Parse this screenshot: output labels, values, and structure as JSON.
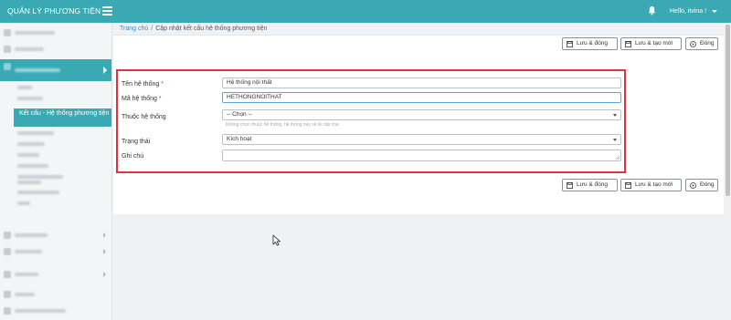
{
  "header": {
    "app_title": "QUẢN LÝ PHƯƠNG TIỆN",
    "user_greeting": "Hello, itvina !",
    "colors": {
      "brand": "#3aa9b4",
      "required": "#e0333a",
      "link": "#2f8fd6"
    },
    "icons": [
      "menu-icon",
      "bell-icon",
      "caret-down-icon"
    ]
  },
  "sidebar": {
    "current_item_label": "Kết cấu - Hệ thống phương tiện",
    "note": "other sidebar labels are blurred in the screenshot"
  },
  "breadcrumb": {
    "home": "Trang chủ",
    "separator": "/",
    "current": "Cập nhật kết cấu hệ thống phương tiện"
  },
  "toolbar": {
    "save_close": "Lưu & đóng",
    "save_new": "Lưu & tạo mới",
    "close": "Đóng"
  },
  "form": {
    "name": {
      "label": "Tên hệ thống",
      "required_mark": "*",
      "value": "Hệ thống nội thất"
    },
    "code": {
      "label": "Mã hệ thống",
      "required_mark": "*",
      "value": "HETHONGNOITHAT"
    },
    "parent": {
      "label": "Thuộc hệ thống",
      "value": "-- Chọn --",
      "hint": "Không chọn thuộc hệ thống, hệ thống này sẽ là cấp cha"
    },
    "status": {
      "label": "Trạng thái",
      "value": "Kích hoạt"
    },
    "note": {
      "label": "Ghi chú",
      "value": ""
    }
  }
}
